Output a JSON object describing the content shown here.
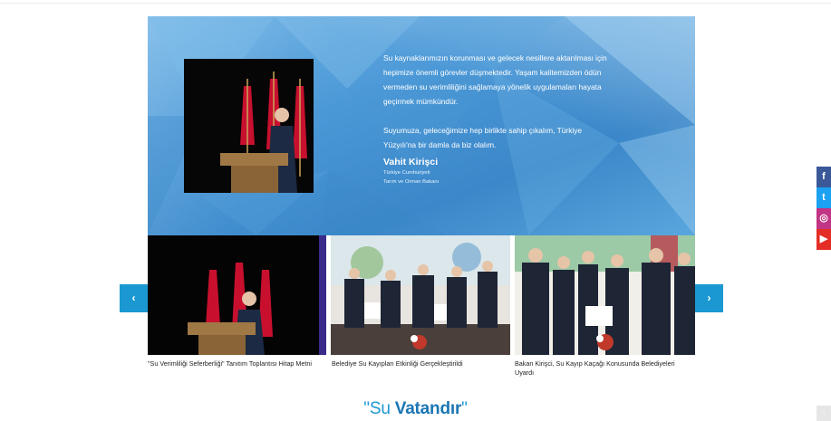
{
  "hero": {
    "quote_line1": "Su kaynaklarımızın korunması ve gelecek nesillere aktarılması için hepimize önemli görevler düşmektedir. Yaşam kalitemizden ödün vermeden su verimliliğini sağlamaya yönelik uygulamaları hayata geçirmek mümkündür.",
    "quote_line2": "Suyumuza, geleceğimize hep birlikte sahip çıkalım, Türkiye Yüzyılı'na bir damla da biz olalım.",
    "name": "Vahit Kirişci",
    "role_line1": "Türkiye Cumhuriyeti",
    "role_line2": "Tarım ve Orman Bakanı"
  },
  "slider": {
    "prev_icon": "‹",
    "next_icon": "›",
    "items": [
      {
        "caption": "\"Su Verimliliği Seferberliği\" Tanıtım Toplantısı Hitap Metni"
      },
      {
        "caption": "Belediye Su Kayıpları Etkinliği Gerçekleştirildi"
      },
      {
        "caption": "Bakan Kirişci, Su Kayıp Kaçağı Konusunda Belediyeleri Uyardı"
      }
    ]
  },
  "tagline": {
    "pre": "\"Su ",
    "bold": "Vatandır",
    "post": "\""
  },
  "social": {
    "facebook": "f",
    "twitter": "t",
    "instagram": "◎",
    "youtube": "▶"
  },
  "to_top_icon": "↑",
  "colors": {
    "accent": "#1b98d2",
    "accent_dark": "#1a76b4",
    "facebook": "#3b5998",
    "twitter": "#1da1f2",
    "instagram": "#c13584",
    "youtube": "#e52d27"
  }
}
